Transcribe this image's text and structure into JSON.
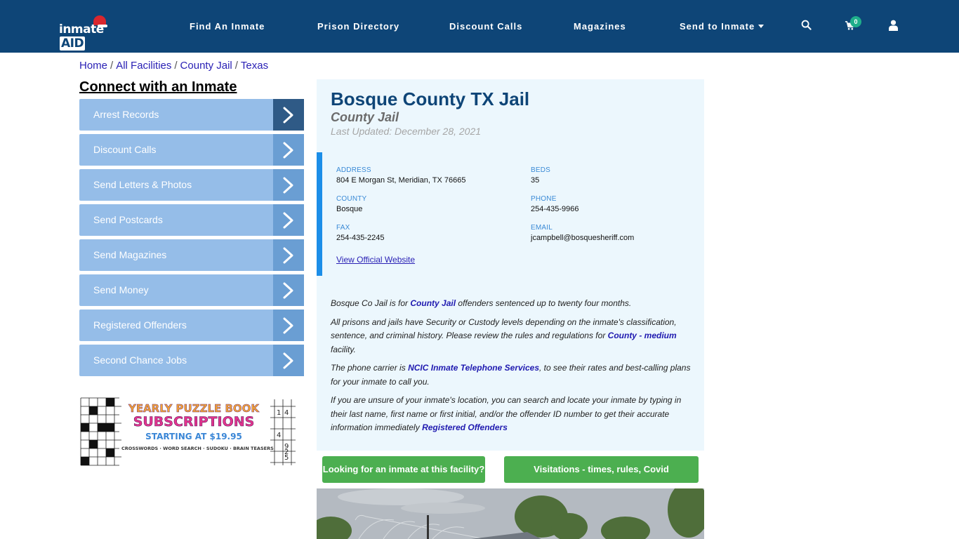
{
  "header": {
    "logo_text": "inmate",
    "logo_accent": "AID",
    "nav": [
      {
        "label": "Find An Inmate"
      },
      {
        "label": "Prison Directory"
      },
      {
        "label": "Discount Calls"
      },
      {
        "label": "Magazines"
      },
      {
        "label": "Send to Inmate",
        "has_dropdown": true
      }
    ],
    "icons": [
      "search-icon",
      "cart-icon",
      "user-icon"
    ],
    "cart_count": "0",
    "colors": {
      "background": "#0e4577",
      "badge": "#1fae8b"
    }
  },
  "breadcrumb": [
    {
      "label": "Home"
    },
    {
      "label": "All Facilities"
    },
    {
      "label": "County Jail"
    },
    {
      "label": "Texas"
    }
  ],
  "breadcrumb_separator": "/",
  "sidebar": {
    "title": "Connect with an Inmate",
    "items": [
      {
        "label": "Arrest Records",
        "active": true
      },
      {
        "label": "Discount Calls"
      },
      {
        "label": "Send Letters & Photos"
      },
      {
        "label": "Send Postcards"
      },
      {
        "label": "Send Magazines"
      },
      {
        "label": "Send Money"
      },
      {
        "label": "Registered Offenders"
      },
      {
        "label": "Second Chance Jobs"
      }
    ],
    "ad": {
      "line1": "YEARLY PUZZLE BOOK",
      "line2": "SUBSCRIPTIONS",
      "line3": "STARTING AT $19.95",
      "line4": "CROSSWORDS · WORD SEARCH · SUDOKU · BRAIN TEASERS"
    }
  },
  "facility": {
    "name": "Bosque County TX Jail",
    "type": "County Jail",
    "last_updated": "Last Updated: December 28, 2021",
    "fields": {
      "address": {
        "label": "ADDRESS",
        "value": "804 E Morgan St, Meridian, TX 76665"
      },
      "beds": {
        "label": "BEDS",
        "value": "35"
      },
      "county": {
        "label": "COUNTY",
        "value": "Bosque"
      },
      "phone": {
        "label": "PHONE",
        "value": "254-435-9966"
      },
      "fax": {
        "label": "FAX",
        "value": "254-435-2245"
      },
      "email": {
        "label": "EMAIL",
        "value": "jcampbell@bosquesheriff.com"
      }
    },
    "official_link": "View Official Website",
    "description": {
      "p1_a": "Bosque Co Jail is for ",
      "p1_link": "County Jail",
      "p1_b": " offenders sentenced up to twenty four months.",
      "p2_a": "All prisons and jails have Security or Custody levels depending on the inmate's classification, sentence, and criminal history. Please review the rules and regulations for ",
      "p2_link": "County - medium",
      "p2_b": " facility.",
      "p3_a": "The phone carrier is ",
      "p3_link": "NCIC Inmate Telephone Services",
      "p3_b": ", to see their rates and best-calling plans for your inmate to call you.",
      "p4_a": "If you are unsure of your inmate's location, you can search and locate your inmate by typing in their last name, first name or first initial, and/or the offender ID number to get their accurate information immediately ",
      "p4_link": "Registered Offenders"
    }
  },
  "buttons": {
    "find_inmate": "Looking for an inmate at this facility?",
    "visitations": "Visitations - times, rules, Covid cancellations"
  }
}
